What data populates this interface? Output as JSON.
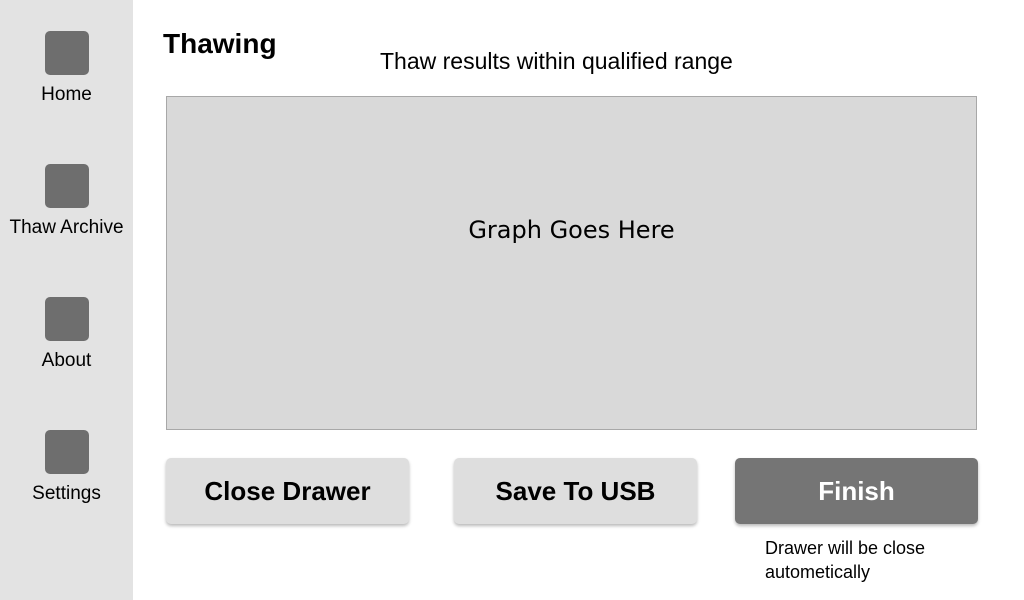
{
  "sidebar": {
    "items": [
      {
        "label": "Home",
        "icon": "home-icon"
      },
      {
        "label": "Thaw Archive",
        "icon": "thaw-archive-icon"
      },
      {
        "label": "About",
        "icon": "about-icon"
      },
      {
        "label": "Settings",
        "icon": "settings-icon"
      }
    ]
  },
  "header": {
    "title": "Thawing",
    "status": "Thaw results within qualified range"
  },
  "main": {
    "graph_placeholder": "Graph Goes Here"
  },
  "actions": {
    "close_drawer_label": "Close Drawer",
    "save_usb_label": "Save To USB",
    "finish_label": "Finish",
    "finish_note": "Drawer will be close autometically"
  },
  "colors": {
    "sidebar_bg": "#e3e3e3",
    "icon_fill": "#6e6e6e",
    "graph_bg": "#d9d9d9",
    "light_button": "#dedede",
    "dark_button": "#757575"
  }
}
